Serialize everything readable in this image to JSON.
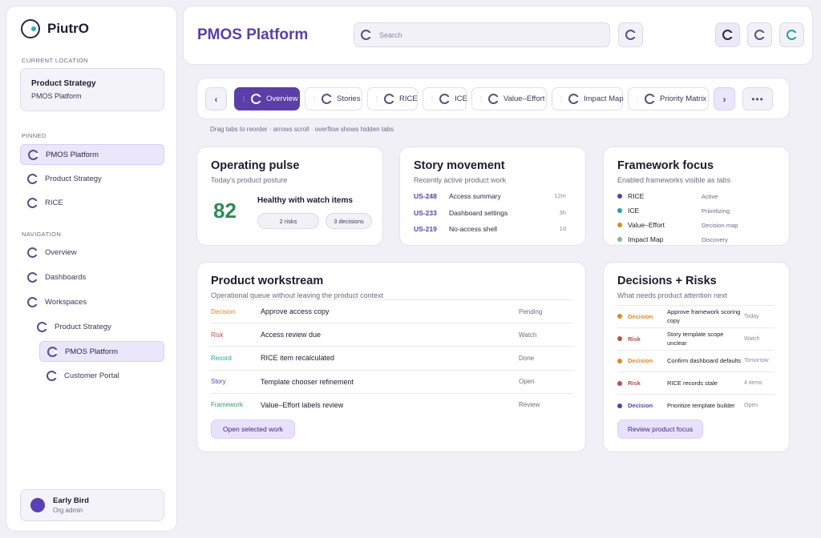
{
  "colors": {
    "accent": "#5b3fa6",
    "decision": "#d98a2b",
    "risk": "#b0524a",
    "record": "#2a9fa0",
    "story": "#5b3fa6",
    "framework": "#3d9a6a",
    "score": "#2f8a55"
  },
  "sidebar": {
    "brand": "PiutrO",
    "current_location_label": "CURRENT LOCATION",
    "location_title": "Product Strategy",
    "location_sub": "PMOS Platform",
    "pinned_label": "PINNED",
    "pinned": [
      {
        "label": "PMOS Platform",
        "icon": "ring-icon"
      },
      {
        "label": "Product Strategy",
        "icon": "ring-icon"
      },
      {
        "label": "RICE",
        "icon": "ring-icon"
      }
    ],
    "navigation_label": "NAVIGATION",
    "navigation": [
      {
        "label": "Overview",
        "icon": "ring-icon"
      },
      {
        "label": "Dashboards",
        "icon": "ring-icon"
      },
      {
        "label": "Workspaces",
        "icon": "ring-icon"
      },
      {
        "label": "Product Strategy",
        "icon": "ring-icon"
      },
      {
        "label": "PMOS Platform",
        "icon": "ring-icon"
      },
      {
        "label": "Customer Portal",
        "icon": "ring-icon"
      }
    ],
    "user_name": "Early Bird",
    "user_role": "Org admin"
  },
  "header": {
    "title": "PMOS Platform",
    "search_placeholder": "Search"
  },
  "tabs": {
    "prev": "‹",
    "next": "›",
    "more": "•••",
    "items": [
      {
        "label": "Overview"
      },
      {
        "label": "Stories"
      },
      {
        "label": "RICE"
      },
      {
        "label": "ICE"
      },
      {
        "label": "Value–Effort"
      },
      {
        "label": "Impact Map"
      },
      {
        "label": "Priority Matrix"
      }
    ],
    "hint": "Drag tabs to reorder · arrows scroll · overflow shows hidden tabs"
  },
  "pulse": {
    "title": "Operating pulse",
    "subtitle": "Today's product posture",
    "score": "82",
    "status": "Healthy with watch items",
    "risks": "2 risks",
    "decisions": "3 decisions"
  },
  "stories": {
    "title": "Story movement",
    "subtitle": "Recently active product work",
    "rows": [
      {
        "id": "US-248",
        "name": "Access summary",
        "time": "12m"
      },
      {
        "id": "US-233",
        "name": "Dashboard settings",
        "time": "3h"
      },
      {
        "id": "US-219",
        "name": "No-access shell",
        "time": "1d"
      }
    ]
  },
  "frameworks": {
    "title": "Framework focus",
    "subtitle": "Enabled frameworks visible as tabs",
    "rows": [
      {
        "name": "RICE",
        "status": "Active",
        "color": "#5b3fa6"
      },
      {
        "name": "ICE",
        "status": "Prioritizing",
        "color": "#2a9fa0"
      },
      {
        "name": "Value–Effort",
        "status": "Decision map",
        "color": "#d98a2b"
      },
      {
        "name": "Impact Map",
        "status": "Discovery",
        "color": "#7fb59a"
      }
    ]
  },
  "workstream": {
    "title": "Product workstream",
    "subtitle": "Operational queue without leaving the product context",
    "rows": [
      {
        "type": "Decision",
        "title": "Approve access copy",
        "status": "Pending",
        "color": "#d98a2b"
      },
      {
        "type": "Risk",
        "title": "Access review due",
        "status": "Watch",
        "color": "#b0524a"
      },
      {
        "type": "Record",
        "title": "RICE item recalculated",
        "status": "Done",
        "color": "#2a9fa0"
      },
      {
        "type": "Story",
        "title": "Template chooser refinement",
        "status": "Open",
        "color": "#5b3fa6"
      },
      {
        "type": "Framework",
        "title": "Value–Effort labels review",
        "status": "Review",
        "color": "#3d9a6a"
      }
    ],
    "button": "Open selected work"
  },
  "decisions": {
    "title": "Decisions + Risks",
    "subtitle": "What needs product attention next",
    "rows": [
      {
        "type": "Decision",
        "title": "Approve framework scoring copy",
        "note": "Today",
        "color": "#d98a2b"
      },
      {
        "type": "Risk",
        "title": "Story template scope unclear",
        "note": "Watch",
        "color": "#b0524a"
      },
      {
        "type": "Decision",
        "title": "Confirm dashboard defaults",
        "note": "Tomorrow",
        "color": "#d98a2b"
      },
      {
        "type": "Risk",
        "title": "RICE records stale",
        "note": "4 items",
        "color": "#b0524a"
      },
      {
        "type": "Decision",
        "title": "Prioritize template builder",
        "note": "Open",
        "color": "#5b3fa6"
      }
    ],
    "button": "Review product focus"
  }
}
